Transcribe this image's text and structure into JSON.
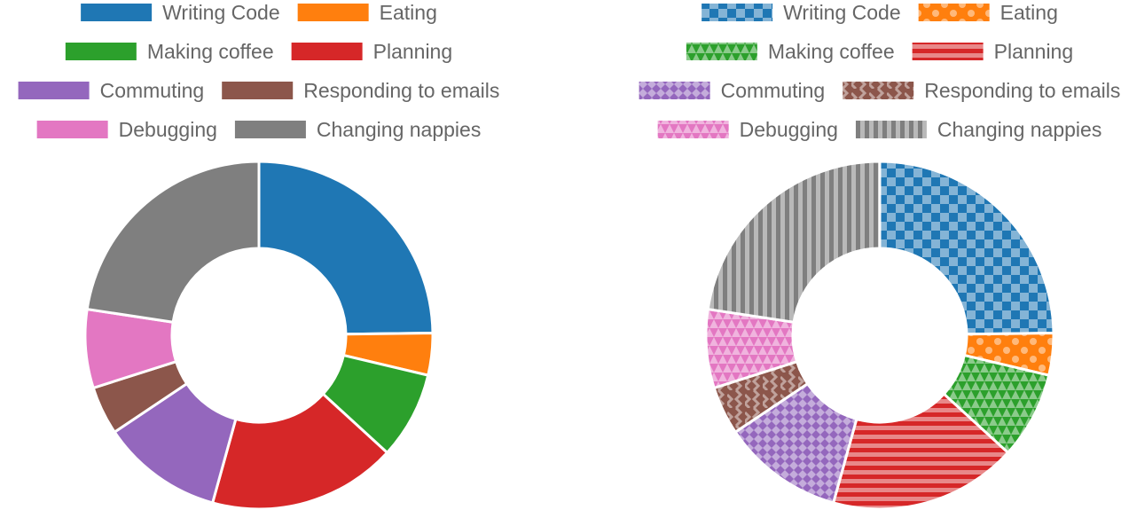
{
  "chart_data": [
    {
      "type": "doughnut",
      "title": "",
      "legend_position": "top",
      "style": "solid",
      "categories": [
        "Writing Code",
        "Eating",
        "Making coffee",
        "Planning",
        "Commuting",
        "Responding to emails",
        "Debugging",
        "Changing nappies"
      ],
      "values": [
        24.8,
        3.9,
        8.1,
        17.5,
        11.3,
        4.5,
        7.3,
        22.6
      ],
      "colors": [
        "#1f77b4",
        "#ff7f0e",
        "#2ca02c",
        "#d62728",
        "#9467bd",
        "#8c564b",
        "#e377c2",
        "#7f7f7f"
      ]
    },
    {
      "type": "doughnut",
      "title": "",
      "legend_position": "top",
      "style": "patterned",
      "categories": [
        "Writing Code",
        "Eating",
        "Making coffee",
        "Planning",
        "Commuting",
        "Responding to emails",
        "Debugging",
        "Changing nappies"
      ],
      "values": [
        24.8,
        3.9,
        8.1,
        17.5,
        11.3,
        4.5,
        7.3,
        22.6
      ],
      "colors": [
        "#1f77b4",
        "#ff7f0e",
        "#2ca02c",
        "#d62728",
        "#9467bd",
        "#8c564b",
        "#e377c2",
        "#7f7f7f"
      ],
      "patterns": [
        "checker",
        "dots",
        "triangles",
        "stripes-horizontal",
        "diamonds",
        "zigzag",
        "triangles",
        "stripes-vertical"
      ]
    }
  ]
}
